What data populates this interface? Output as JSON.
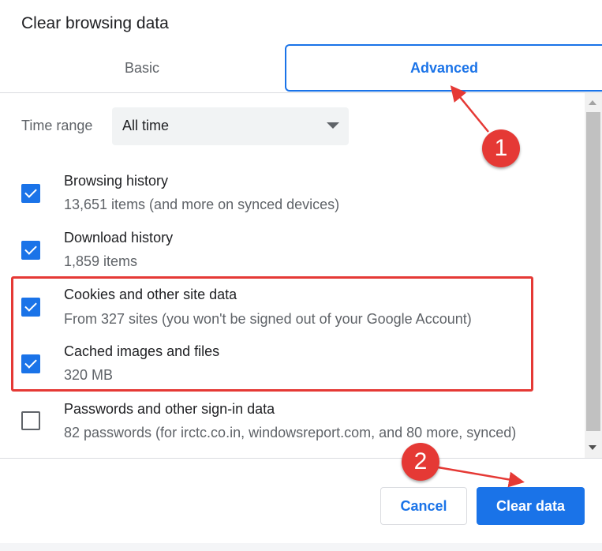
{
  "dialog": {
    "title": "Clear browsing data"
  },
  "tabs": [
    {
      "label": "Basic",
      "active": false
    },
    {
      "label": "Advanced",
      "active": true
    }
  ],
  "time_range": {
    "label": "Time range",
    "value": "All time"
  },
  "items": [
    {
      "title": "Browsing history",
      "description": "13,651 items (and more on synced devices)",
      "checked": true
    },
    {
      "title": "Download history",
      "description": "1,859 items",
      "checked": true
    },
    {
      "title": "Cookies and other site data",
      "description": "From 327 sites (you won't be signed out of your Google Account)",
      "checked": true
    },
    {
      "title": "Cached images and files",
      "description": "320 MB",
      "checked": true
    },
    {
      "title": "Passwords and other sign-in data",
      "description": "82 passwords (for irctc.co.in, windowsreport.com, and 80 more, synced)",
      "checked": false
    }
  ],
  "buttons": {
    "cancel": "Cancel",
    "clear": "Clear data"
  },
  "annotations": {
    "step1": "1",
    "step2": "2"
  },
  "colors": {
    "accent": "#1a73e8",
    "annotation": "#e53935"
  }
}
